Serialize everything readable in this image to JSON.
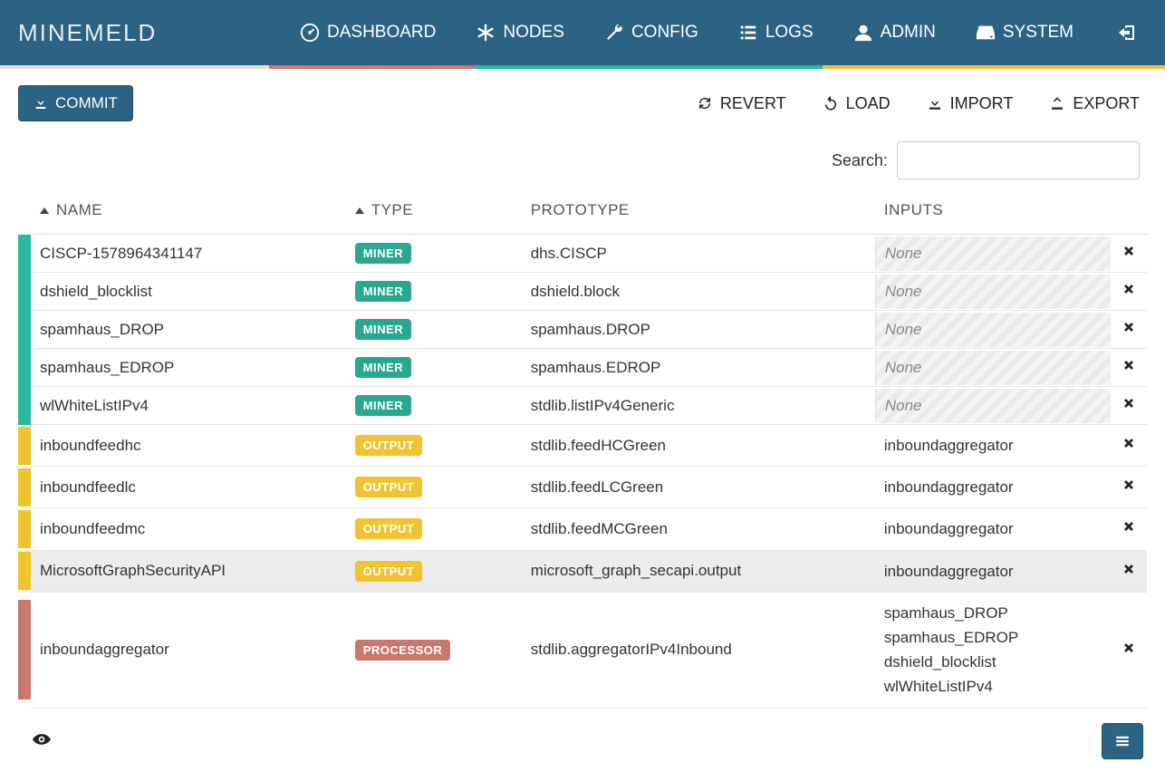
{
  "brand": "MINEMELD",
  "nav": {
    "dashboard": "DASHBOARD",
    "nodes": "NODES",
    "config": "CONFIG",
    "logs": "LOGS",
    "admin": "ADMIN",
    "system": "SYSTEM"
  },
  "toolbar": {
    "commit": "COMMIT",
    "revert": "REVERT",
    "load": "LOAD",
    "import": "IMPORT",
    "export": "EXPORT"
  },
  "search": {
    "label": "Search:",
    "value": ""
  },
  "columns": {
    "name": "NAME",
    "type": "TYPE",
    "prototype": "PROTOTYPE",
    "inputs": "INPUTS"
  },
  "type_labels": {
    "miner": "MINER",
    "output": "OUTPUT",
    "processor": "PROCESSOR"
  },
  "none_label": "None",
  "rows": [
    {
      "name": "CISCP-1578964341147",
      "type": "miner",
      "prototype": "dhs.CISCP",
      "inputs": []
    },
    {
      "name": "dshield_blocklist",
      "type": "miner",
      "prototype": "dshield.block",
      "inputs": []
    },
    {
      "name": "spamhaus_DROP",
      "type": "miner",
      "prototype": "spamhaus.DROP",
      "inputs": []
    },
    {
      "name": "spamhaus_EDROP",
      "type": "miner",
      "prototype": "spamhaus.EDROP",
      "inputs": []
    },
    {
      "name": "wlWhiteListIPv4",
      "type": "miner",
      "prototype": "stdlib.listIPv4Generic",
      "inputs": []
    },
    {
      "name": "inboundfeedhc",
      "type": "output",
      "prototype": "stdlib.feedHCGreen",
      "inputs": [
        "inboundaggregator"
      ]
    },
    {
      "name": "inboundfeedlc",
      "type": "output",
      "prototype": "stdlib.feedLCGreen",
      "inputs": [
        "inboundaggregator"
      ]
    },
    {
      "name": "inboundfeedmc",
      "type": "output",
      "prototype": "stdlib.feedMCGreen",
      "inputs": [
        "inboundaggregator"
      ]
    },
    {
      "name": "MicrosoftGraphSecurityAPI",
      "type": "output",
      "prototype": "microsoft_graph_secapi.output",
      "inputs": [
        "inboundaggregator"
      ]
    },
    {
      "name": "inboundaggregator",
      "type": "processor",
      "prototype": "stdlib.aggregatorIPv4Inbound",
      "inputs": [
        "spamhaus_DROP",
        "spamhaus_EDROP",
        "dshield_blocklist",
        "wlWhiteListIPv4"
      ]
    }
  ]
}
